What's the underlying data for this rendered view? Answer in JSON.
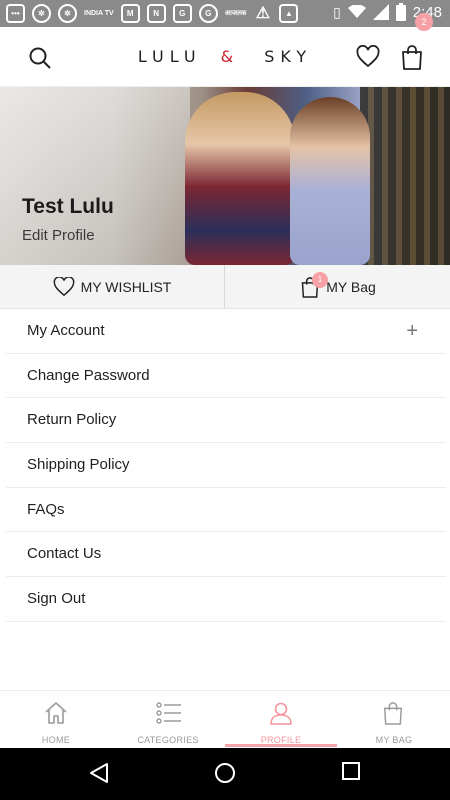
{
  "status_bar": {
    "time": "2:48",
    "icons": [
      "messages-icon",
      "settings-icon",
      "settings-icon",
      "india-tv-icon",
      "gmail-icon",
      "n-icon",
      "g-icon",
      "g-icon",
      "hindi-text-icon",
      "warning-icon",
      "image-icon",
      "vibrate-icon",
      "wifi-icon",
      "signal-icon",
      "battery-icon"
    ],
    "india_tv_label": "INDIA TV",
    "hindi_label": "आजतक"
  },
  "header": {
    "brand_left": "LULU",
    "brand_amp": "&",
    "brand_right": "SKY",
    "bag_count": "2",
    "accent_color": "#d21f2c",
    "badge_color": "#f7a0a6"
  },
  "profile": {
    "name": "Test Lulu",
    "edit_label": "Edit Profile"
  },
  "quick_links": {
    "wishlist_label": "MY WISHLIST",
    "bag_label": "MY Bag",
    "bag_count": "1"
  },
  "menu": {
    "items": [
      {
        "label": "My Account",
        "expand_symbol": "+"
      },
      {
        "label": "Change Password"
      },
      {
        "label": "Return Policy"
      },
      {
        "label": "Shipping Policy"
      },
      {
        "label": "FAQs"
      },
      {
        "label": "Contact Us"
      },
      {
        "label": "Sign Out"
      }
    ]
  },
  "bottom_nav": {
    "items": [
      {
        "label": "HOME",
        "icon": "home-icon"
      },
      {
        "label": "CATEGORIES",
        "icon": "list-icon"
      },
      {
        "label": "PROFILE",
        "icon": "person-icon",
        "active": true
      },
      {
        "label": "MY BAG",
        "icon": "bag-icon"
      }
    ],
    "active_color": "#f4949b"
  }
}
